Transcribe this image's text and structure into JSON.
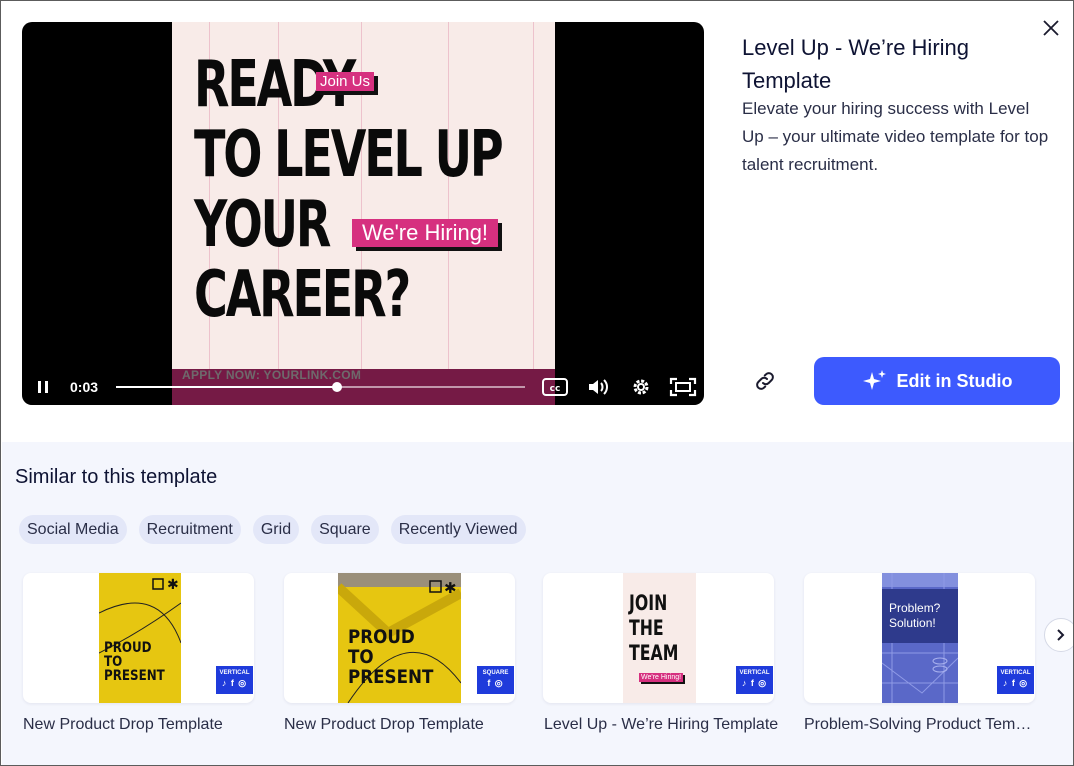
{
  "player": {
    "poster": {
      "headline_lines": [
        "READY",
        "TO LEVEL UP",
        "YOUR",
        "CAREER?"
      ],
      "tag_join": "Join Us",
      "tag_hiring": "We're Hiring!",
      "apply_text": "APPLY NOW: YOURLINK.COM",
      "accent_color": "#d6307f"
    },
    "controls": {
      "time": "0:03",
      "progress": 0.54,
      "play_icon": "pause-icon",
      "cc_icon": "closed-captions-icon",
      "volume_icon": "volume-icon",
      "settings_icon": "gear-icon",
      "fullscreen_icon": "fullscreen-icon"
    }
  },
  "info": {
    "title": "Level Up - We’re Hiring Template",
    "description": "Elevate your hiring success with Level Up – your ultimate video template for top talent recruitment.",
    "edit_button": "Edit in Studio",
    "edit_button_color": "#3d5afe",
    "link_icon": "link-icon",
    "close_icon": "close-icon"
  },
  "similar": {
    "title": "Similar to this template",
    "chips": [
      "Social Media",
      "Recruitment",
      "Grid",
      "Square",
      "Recently Viewed"
    ],
    "cards": [
      {
        "label": "New Product Drop Template",
        "thumb_text": [
          "PROUD",
          "TO",
          "PRESENT"
        ],
        "badge": "VERTICAL",
        "badge_icons": "tiktok facebook instagram"
      },
      {
        "label": "New Product Drop Template",
        "thumb_text": [
          "PROUD",
          "TO",
          "PRESENT"
        ],
        "badge": "SQUARE",
        "badge_icons": "facebook instagram"
      },
      {
        "label": "Level Up - We’re Hiring Template",
        "thumb_text": [
          "JOIN",
          "THE",
          "TEAM"
        ],
        "thumb_tag": "We're Hiring!",
        "badge": "VERTICAL",
        "badge_icons": "tiktok facebook instagram"
      },
      {
        "label": "Problem-Solving Product Templ...",
        "thumb_text": [
          "Problem?",
          "Solution!"
        ],
        "badge": "VERTICAL",
        "badge_icons": "tiktok facebook instagram"
      }
    ],
    "next_icon": "chevron-right-icon"
  }
}
